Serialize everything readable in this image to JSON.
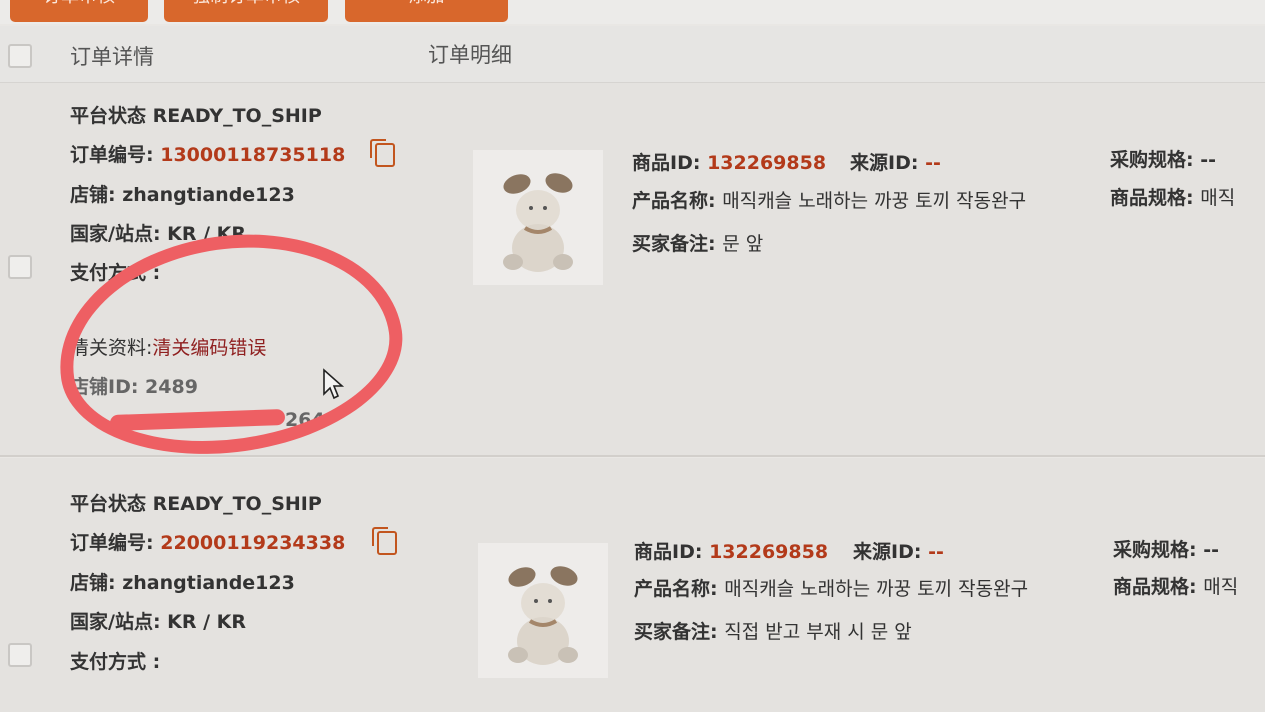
{
  "toolbar": {
    "buttons": [
      "订单审核",
      "强制订单审核",
      "添加"
    ]
  },
  "table_header": {
    "col_details": "订单详情",
    "col_items": "订单明细"
  },
  "orders": [
    {
      "platform_status": "平台状态 READY_TO_SHIP",
      "order_no_label": "订单编号:",
      "order_no": "13000118735118",
      "shop": "店铺: zhangtiande123",
      "country": "国家/站点: KR / KR",
      "payment": "支付方式 :",
      "customs_label": "清关资料:",
      "customs_value": "清关编码错误",
      "shop_id": "店铺ID: 2489",
      "shipping_partial": "264",
      "product_id_label": "商品ID:",
      "product_id": "132269858",
      "source_id_label": "来源ID:",
      "source_id": "--",
      "purchase_spec_label": "采购规格:",
      "purchase_spec": "--",
      "product_name_label": "产品名称:",
      "product_name": "매직캐슬 노래하는 까꿍 토끼 작동완구",
      "product_spec_label": "商品规格:",
      "product_spec": "매직",
      "buyer_note_label": "买家备注:",
      "buyer_note": "문 앞"
    },
    {
      "platform_status": "平台状态 READY_TO_SHIP",
      "order_no_label": "订单编号:",
      "order_no": "22000119234338",
      "shop": "店铺: zhangtiande123",
      "country": "国家/站点: KR / KR",
      "payment": "支付方式 :",
      "product_id_label": "商品ID:",
      "product_id": "132269858",
      "source_id_label": "来源ID:",
      "source_id": "--",
      "purchase_spec_label": "采购规格:",
      "purchase_spec": "--",
      "product_name_label": "产品名称:",
      "product_name": "매직캐슬 노래하는 까꿍 토끼 작동완구",
      "product_spec_label": "商品规格:",
      "product_spec": "매직",
      "buyer_note_label": "买家备注:",
      "buyer_note": "직접 받고 부재 시 문 앞"
    }
  ],
  "colors": {
    "accent": "#d8672c",
    "order_no": "#b33a1a",
    "annotation": "#ee5f63"
  }
}
